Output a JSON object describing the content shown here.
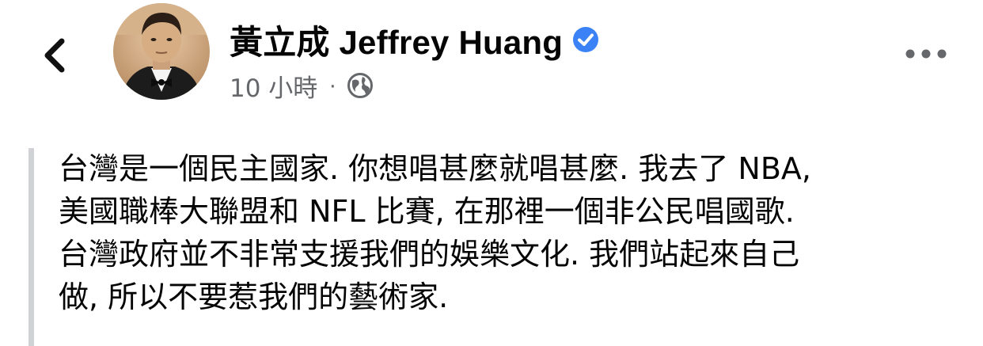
{
  "header": {
    "back_icon": "chevron-left-icon",
    "author_name": "黃立成 Jeffrey Huang",
    "verified_icon": "verified-badge-icon",
    "verified_color": "#3b82f6",
    "timestamp": "10 小時",
    "separator": "·",
    "audience_icon": "globe-icon",
    "more_icon": "ellipsis-icon"
  },
  "post": {
    "lines": [
      "台灣是一個民主國家. 你想唱甚麼就唱甚麼. 我去了 NBA,",
      "美國職棒大聯盟和 NFL 比賽, 在那裡一個非公民唱國歌.",
      "台灣政府並不非常支援我們的娛樂文化. 我們站起來自己",
      "做, 所以不要惹我們的藝術家."
    ]
  },
  "colors": {
    "text": "#050505",
    "secondary": "#65676b",
    "quote_bar": "#d0d2d6"
  }
}
